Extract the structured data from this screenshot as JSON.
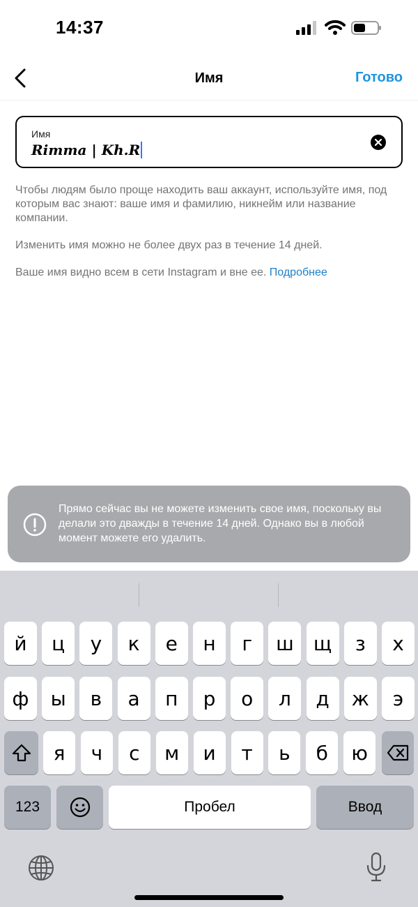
{
  "status_bar": {
    "time": "14:37"
  },
  "nav": {
    "title": "Имя",
    "done_label": "Готово"
  },
  "name_field": {
    "label": "Имя",
    "value": "Rimma | Kh.R"
  },
  "help": {
    "paragraph_1": "Чтобы людям было проще находить ваш аккаунт, используйте имя, под которым вас знают: ваше имя и фамилию, никнейм или название компании.",
    "paragraph_2": "Изменить имя можно не более двух раз в течение 14 дней.",
    "paragraph_3": "Ваше имя видно всем в сети Instagram и вне ее.",
    "learn_more": "Подробнее"
  },
  "toast": {
    "message": "Прямо сейчас вы не можете изменить свое имя, поскольку вы делали это дважды в течение 14 дней. Однако вы в любой момент можете его удалить."
  },
  "keyboard": {
    "row1": [
      "й",
      "ц",
      "у",
      "к",
      "е",
      "н",
      "г",
      "ш",
      "щ",
      "з",
      "х"
    ],
    "row2": [
      "ф",
      "ы",
      "в",
      "а",
      "п",
      "р",
      "о",
      "л",
      "д",
      "ж",
      "э"
    ],
    "row3": [
      "я",
      "ч",
      "с",
      "м",
      "и",
      "т",
      "ь",
      "б",
      "ю"
    ],
    "numbers_label": "123",
    "space_label": "Пробел",
    "return_label": "Ввод"
  },
  "colors": {
    "accent": "#1e95de",
    "link": "#1e7fc8",
    "toast_bg": "#a8a9ac",
    "keyboard_bg": "#d3d5db"
  }
}
